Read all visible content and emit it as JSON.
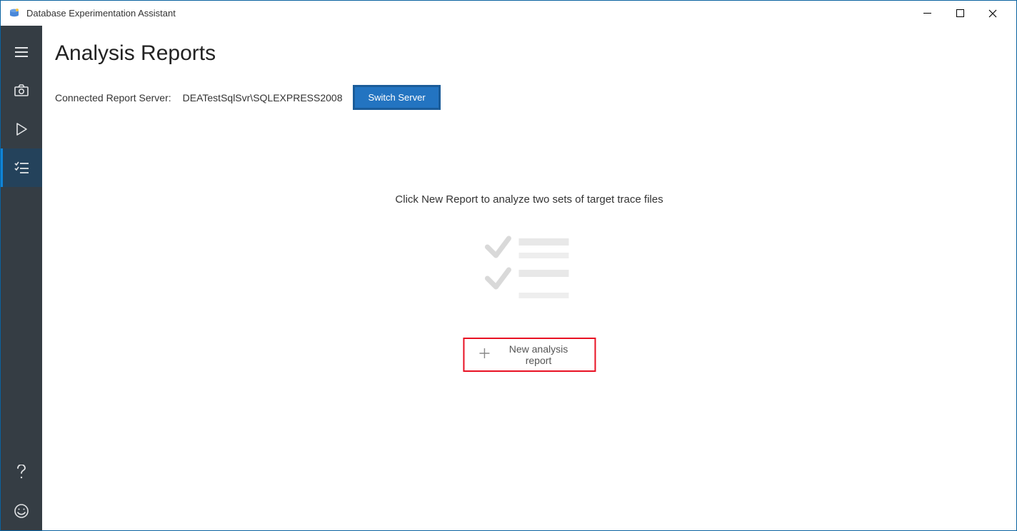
{
  "window": {
    "title": "Database Experimentation Assistant"
  },
  "page": {
    "title": "Analysis Reports"
  },
  "server": {
    "label": "Connected Report Server:",
    "value": "DEATestSqlSvr\\SQLEXPRESS2008",
    "switch_label": "Switch Server"
  },
  "empty": {
    "hint": "Click New Report to analyze two sets of target trace files",
    "new_report_label": "New analysis report"
  }
}
